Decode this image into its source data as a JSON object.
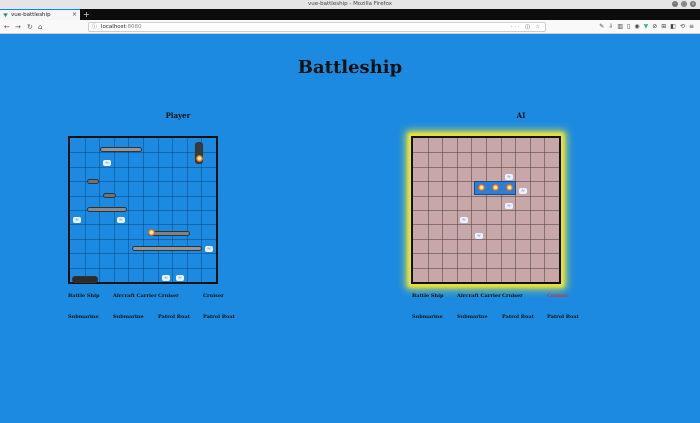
{
  "browser": {
    "window_title": "vue-battleship - Mozilla Firefox",
    "tab_label": "vue-battleship",
    "url_host": "localhost",
    "url_port": ":8080"
  },
  "page": {
    "title": "Battleship",
    "player": {
      "label": "Player",
      "ships_row1": [
        "Battle Ship",
        "Aircraft Carrier",
        "Cruiser",
        "Cruiser"
      ],
      "ships_row2": [
        "Submarine",
        "Submarine",
        "Patrol Boat",
        "Patrol Boat"
      ]
    },
    "ai": {
      "label": "AI",
      "ships_row1": [
        "Battle Ship",
        "Aircraft Carrier",
        "Cruiser",
        "Cruiser"
      ],
      "ships_row2": [
        "Submarine",
        "Submarine",
        "Patrol Boat",
        "Patrol Boat"
      ],
      "sunk_row1": [
        false,
        false,
        false,
        true
      ]
    }
  },
  "colors": {
    "background": "#1b8ae0",
    "ai_board": "#c7a7a7",
    "ai_glow": "#e6e23a",
    "sunk_text": "#d9322e"
  },
  "icons": [
    "firefox-tab-icon",
    "back-icon",
    "forward-icon",
    "reload-icon",
    "home-icon",
    "info-icon",
    "more-icon",
    "pocket-icon",
    "bookmark-star-icon",
    "library-icon",
    "sidebar-icon",
    "menu-icon",
    "fire-icon",
    "splash-icon"
  ]
}
